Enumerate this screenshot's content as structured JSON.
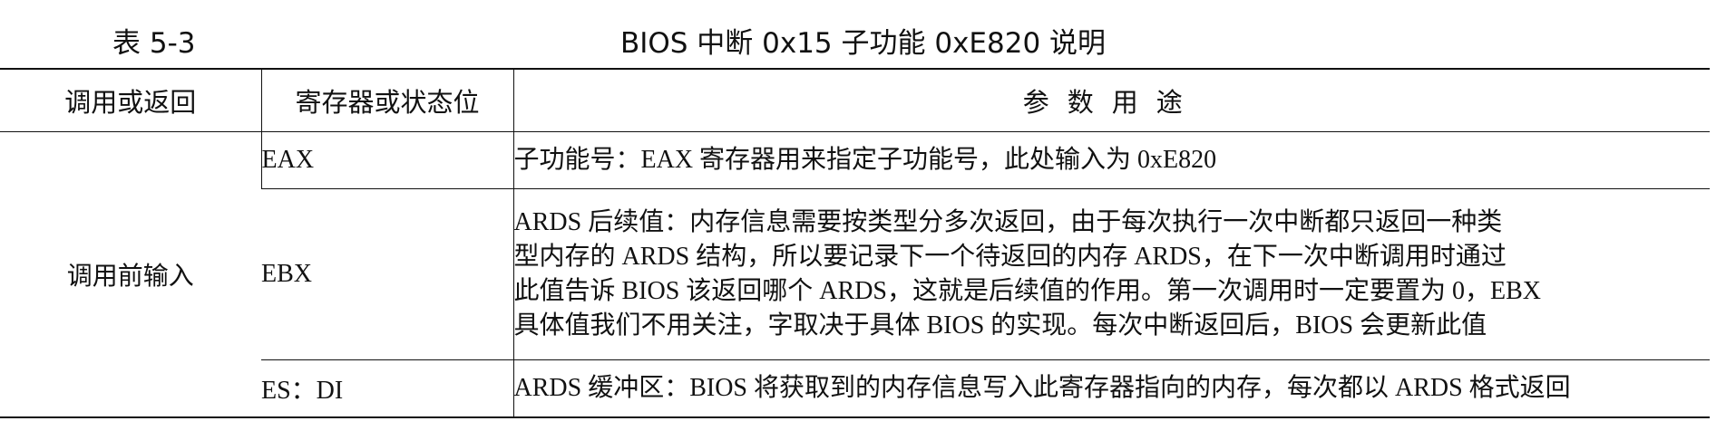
{
  "caption": {
    "label": "表 5-3",
    "title": "BIOS 中断 0x15 子功能 0xE820 说明"
  },
  "table": {
    "headers": [
      "调用或返回",
      "寄存器或状态位",
      "参数用途"
    ],
    "call_group": "调用前输入",
    "rows": [
      {
        "register": "EAX",
        "lines": [
          "子功能号：EAX 寄存器用来指定子功能号，此处输入为 0xE820"
        ]
      },
      {
        "register": "EBX",
        "lines": [
          "ARDS 后续值：内存信息需要按类型分多次返回，由于每次执行一次中断都只返回一种类",
          "型内存的 ARDS 结构，所以要记录下一个待返回的内存 ARDS，在下一次中断调用时通过",
          "此值告诉 BIOS 该返回哪个 ARDS，这就是后续值的作用。第一次调用时一定要置为 0，EBX",
          "具体值我们不用关注，字取决于具体 BIOS 的实现。每次中断返回后，BIOS 会更新此值"
        ]
      },
      {
        "register": "ES：DI",
        "lines": [
          "ARDS 缓冲区：BIOS 将获取到的内存信息写入此寄存器指向的内存，每次都以 ARDS 格式返回"
        ]
      }
    ]
  }
}
